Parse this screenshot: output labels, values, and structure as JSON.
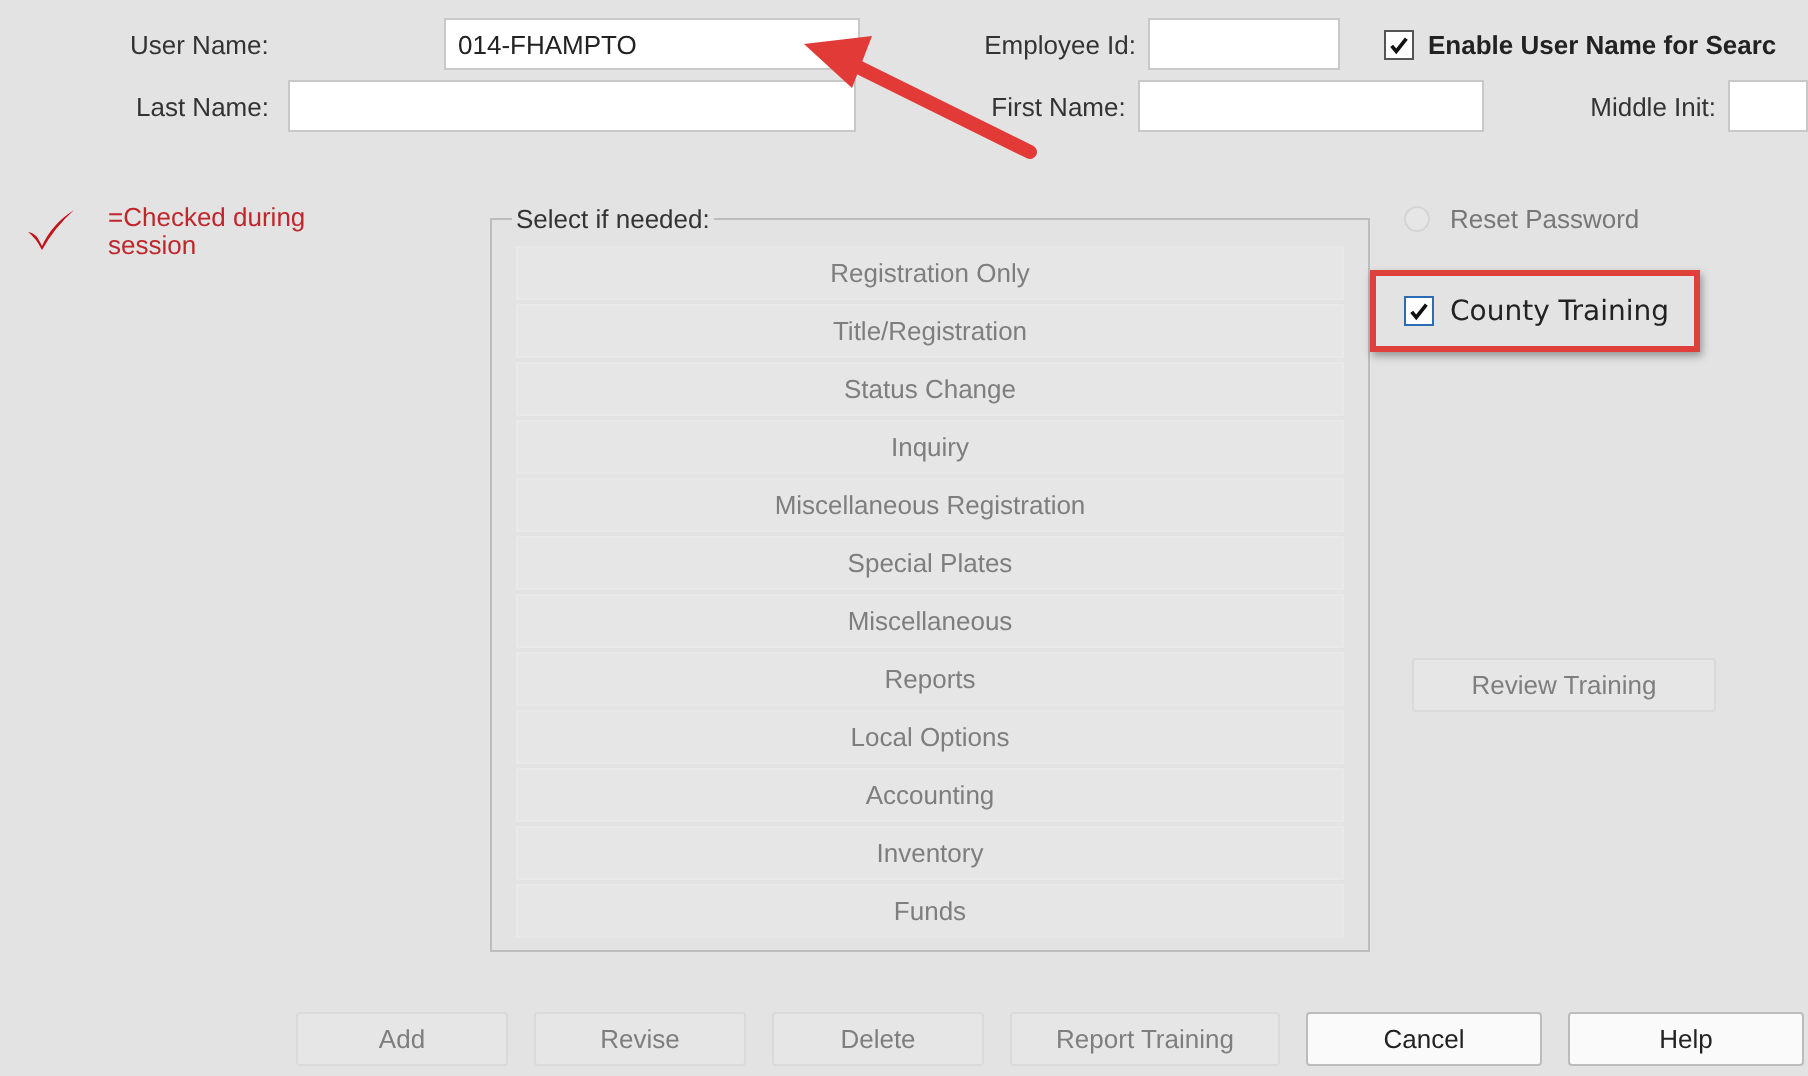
{
  "user_name": {
    "label": "User Name:",
    "value": "014-FHAMPTO"
  },
  "employee_id": {
    "label": "Employee Id:"
  },
  "enable_search": {
    "label": "Enable User Name for Searc",
    "checked": true
  },
  "last_name": {
    "label": "Last Name:"
  },
  "first_name": {
    "label": "First Name:"
  },
  "middle_init": {
    "label": "Middle Init:"
  },
  "legend": {
    "text": "=Checked during session"
  },
  "group": {
    "title": "Select if needed:",
    "options": [
      {
        "label": "Registration Only",
        "disabled": true
      },
      {
        "label": "Title/Registration",
        "disabled": true
      },
      {
        "label": "Status Change",
        "disabled": true
      },
      {
        "label": "Inquiry",
        "disabled": true
      },
      {
        "label": "Miscellaneous Registration",
        "disabled": true
      },
      {
        "label": "Special Plates",
        "disabled": true
      },
      {
        "label": "Miscellaneous",
        "disabled": true
      },
      {
        "label": "Reports",
        "disabled": true
      },
      {
        "label": "Local Options",
        "disabled": true
      },
      {
        "label": "Accounting",
        "disabled": true
      },
      {
        "label": "Inventory",
        "disabled": true
      },
      {
        "label": "Funds",
        "disabled": true
      }
    ]
  },
  "reset_password": {
    "label": "Reset Password",
    "checked": false,
    "disabled": true
  },
  "county_training": {
    "label": "County Training",
    "checked": true,
    "highlighted": true
  },
  "review_training": {
    "label": "Review Training",
    "disabled": true
  },
  "buttons": [
    {
      "label": "Add",
      "disabled": true
    },
    {
      "label": "Revise",
      "disabled": true
    },
    {
      "label": "Delete",
      "disabled": true
    },
    {
      "label": "Report Training",
      "disabled": true
    },
    {
      "label": "Cancel",
      "disabled": false
    },
    {
      "label": "Help",
      "disabled": false
    }
  ],
  "annotation": {
    "kind": "arrow"
  }
}
